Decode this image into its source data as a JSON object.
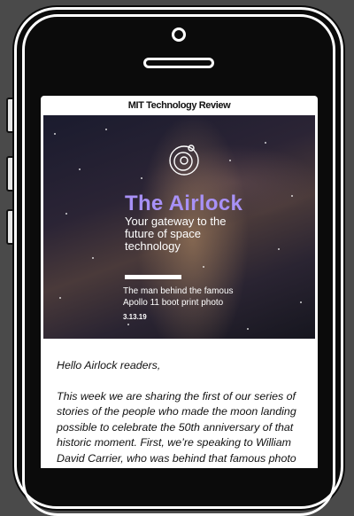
{
  "brand": {
    "name": "MIT Technology Review"
  },
  "hero": {
    "title": "The Airlock",
    "subtitle": "Your gateway to the future of space technology",
    "caption": "The man behind the famous Apollo 11 boot print photo",
    "date": "3.13.19",
    "icon": "orbit-logo-icon"
  },
  "body": {
    "greeting": "Hello Airlock readers,",
    "paragraph": "This week we are sharing the first of our series of stories of the people who made the moon landing possible to celebrate the 50th anniversary of that historic moment. First, we’re speaking to William David Carrier, who was behind that famous photo"
  },
  "colors": {
    "accent": "#a891f7",
    "device": "#0b0b0b",
    "background": "#4a4a4a"
  }
}
